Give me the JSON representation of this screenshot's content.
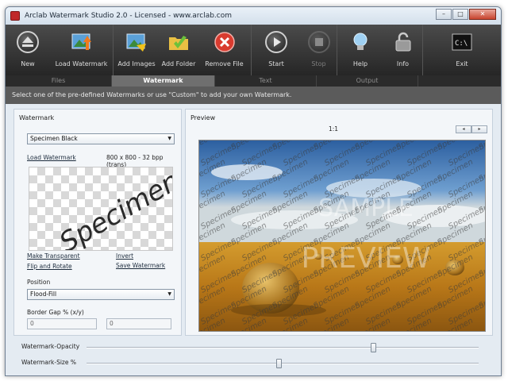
{
  "window": {
    "title": "Arclab Watermark Studio 2.0 - Licensed - www.arclab.com"
  },
  "toolbar": [
    {
      "label": "New",
      "icon": "eject-icon",
      "enabled": true
    },
    {
      "label": "Load Watermark",
      "icon": "image-arrow-icon",
      "enabled": true
    },
    {
      "label": "Add Images",
      "icon": "image-add-icon",
      "enabled": true
    },
    {
      "label": "Add Folder",
      "icon": "folder-add-icon",
      "enabled": true
    },
    {
      "label": "Remove File",
      "icon": "remove-icon",
      "enabled": true
    },
    {
      "label": "Start",
      "icon": "play-icon",
      "enabled": true
    },
    {
      "label": "Stop",
      "icon": "stop-icon",
      "enabled": false
    },
    {
      "label": "Help",
      "icon": "lightbulb-icon",
      "enabled": true
    },
    {
      "label": "Info",
      "icon": "lock-icon",
      "enabled": true
    },
    {
      "label": "Exit",
      "icon": "terminal-icon",
      "enabled": true
    }
  ],
  "tabs": [
    {
      "label": "Files",
      "active": false
    },
    {
      "label": "Watermark",
      "active": true
    },
    {
      "label": "Text",
      "active": false
    },
    {
      "label": "Output",
      "active": false
    }
  ],
  "info_text": "Select one of the pre-defined Watermarks or use \"Custom\" to add your own Watermark.",
  "watermark_panel": {
    "title": "Watermark",
    "preset_value": "Specimen Black",
    "load_link": "Load Watermark",
    "dimensions": "800 x 800 - 32 bpp (trans)",
    "watermark_text": "Specimen",
    "make_transparent": "Make Transparent",
    "invert": "Invert",
    "flip_rotate": "Flip and Rotate",
    "save_watermark": "Save Watermark",
    "position_label": "Position",
    "position_value": "Flood-Fill",
    "border_gap_label": "Border Gap % (x/y)",
    "gap_x": "0",
    "gap_y": "0"
  },
  "preview_panel": {
    "title": "Preview",
    "zoom": "1:1",
    "prev_label": "◂",
    "next_label": "▸",
    "overlay_sample": "SAMPLE",
    "overlay_preview": "PREVIEW",
    "tile_text": "Specimen"
  },
  "sliders": {
    "opacity_label": "Watermark-Opacity",
    "opacity_value": 0.73,
    "size_label": "Watermark-Size %",
    "size_value": 0.49
  },
  "colors": {
    "toolbar_bg": "#2e2e2e",
    "active_tab": "#6f6f6f",
    "panel_bg": "#e4ebf2"
  }
}
